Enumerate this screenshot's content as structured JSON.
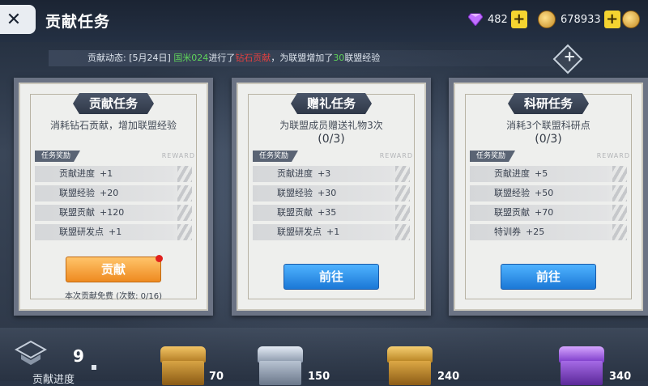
{
  "header": {
    "title": "贡献任务",
    "back_glyph": "✕",
    "gems": "482",
    "gold": "678933",
    "plus": "+"
  },
  "news": {
    "prefix": "贡献动态:",
    "date": "[5月24日]",
    "player": "国米024",
    "middle": "进行了",
    "action": "钻石贡献",
    "suffix1": "，为联盟增加了",
    "amount": "30",
    "suffix2": "联盟经验"
  },
  "cards": [
    {
      "title": "贡献任务",
      "desc": "消耗钻石贡献，增加联盟经验",
      "progress": "",
      "reward_tag": "任务奖励",
      "reward_en": "REWARD",
      "rewards": [
        {
          "label": "贡献进度",
          "amount": "+1"
        },
        {
          "label": "联盟经验",
          "amount": "+20"
        },
        {
          "label": "联盟贡献",
          "amount": "+120"
        },
        {
          "label": "联盟研发点",
          "amount": "+1"
        }
      ],
      "button": "贡献",
      "note": "本次贡献免费 (次数: 0/16)"
    },
    {
      "title": "赠礼任务",
      "desc": "为联盟成员赠送礼物3次",
      "progress": "(0/3)",
      "reward_tag": "任务奖励",
      "reward_en": "REWARD",
      "rewards": [
        {
          "label": "贡献进度",
          "amount": "+3"
        },
        {
          "label": "联盟经验",
          "amount": "+30"
        },
        {
          "label": "联盟贡献",
          "amount": "+35"
        },
        {
          "label": "联盟研发点",
          "amount": "+1"
        }
      ],
      "button": "前往"
    },
    {
      "title": "科研任务",
      "desc": "消耗3个联盟科研点",
      "progress": "(0/3)",
      "reward_tag": "任务奖励",
      "reward_en": "REWARD",
      "rewards": [
        {
          "label": "贡献进度",
          "amount": "+5"
        },
        {
          "label": "联盟经验",
          "amount": "+50"
        },
        {
          "label": "联盟贡献",
          "amount": "+70"
        },
        {
          "label": "特训券",
          "amount": "+25"
        }
      ],
      "button": "前往"
    }
  ],
  "bottom": {
    "contrib_count": "9",
    "contrib_label": "贡献进度",
    "chests": [
      {
        "name": "gold-chest",
        "count": "70",
        "color": "#c9932e"
      },
      {
        "name": "silver-chest",
        "count": "150",
        "color": "#9aa6b8"
      },
      {
        "name": "gold-chest-2",
        "count": "240",
        "color": "#d09a33"
      },
      {
        "name": "purple-chest",
        "count": "340",
        "color": "#8a4fd0"
      }
    ]
  }
}
